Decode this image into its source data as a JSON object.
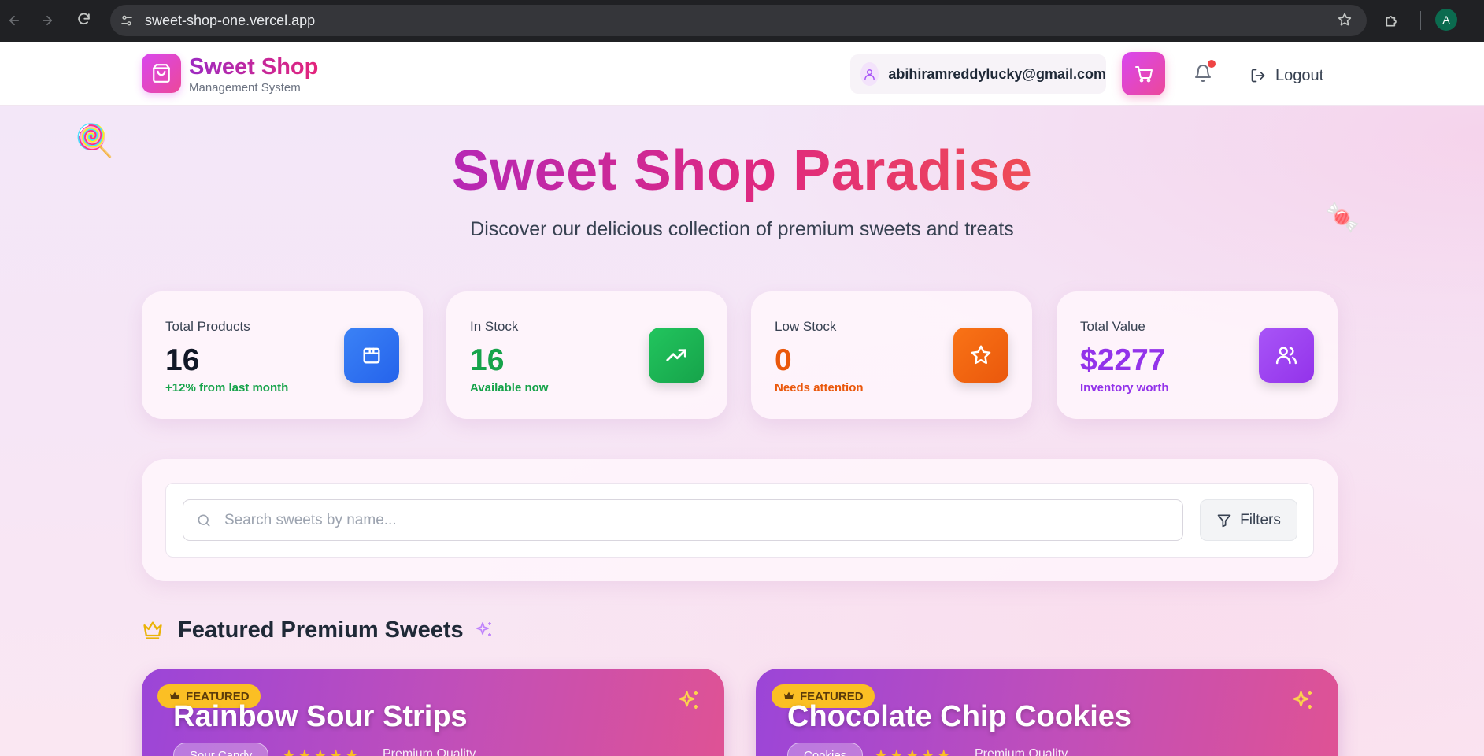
{
  "browser": {
    "url": "sweet-shop-one.vercel.app",
    "profile_initial": "A"
  },
  "header": {
    "brand_title": "Sweet Shop",
    "brand_subtitle": "Management System",
    "user_email": "abihiramreddylucky@gmail.com",
    "logout_label": "Logout",
    "notification_dot_color": "#ef4444"
  },
  "hero": {
    "title": "Sweet Shop Paradise",
    "subtitle": "Discover our delicious collection of premium sweets and treats"
  },
  "decorations": {
    "lollipop": "🍭",
    "candy": "🍬"
  },
  "stats": [
    {
      "label": "Total Products",
      "value": "16",
      "note": "+12% from last month",
      "value_color": "#111827",
      "note_color": "#16a34a",
      "icon": "box-icon",
      "icon_bg": "#3b82f6"
    },
    {
      "label": "In Stock",
      "value": "16",
      "note": "Available now",
      "value_color": "#16a34a",
      "note_color": "#16a34a",
      "icon": "trending-up-icon",
      "icon_bg": "#22c55e"
    },
    {
      "label": "Low Stock",
      "value": "0",
      "note": "Needs attention",
      "value_color": "#ea580c",
      "note_color": "#ea580c",
      "icon": "star-icon",
      "icon_bg": "#f97316"
    },
    {
      "label": "Total Value",
      "value": "$2277",
      "note": "Inventory worth",
      "value_color": "#9333ea",
      "note_color": "#9333ea",
      "icon": "users-icon",
      "icon_bg": "#a855f7"
    }
  ],
  "search": {
    "placeholder": "Search sweets by name...",
    "value": "",
    "filters_label": "Filters"
  },
  "featured": {
    "section_title": "Featured Premium Sweets",
    "badge_label": "FEATURED",
    "items": [
      {
        "name": "Rainbow Sour Strips",
        "category": "Sour Candy",
        "rating": "★★★★★",
        "quality": "Premium Quality"
      },
      {
        "name": "Chocolate Chip Cookies",
        "category": "Cookies",
        "rating": "★★★★★",
        "quality": "Premium Quality"
      }
    ]
  },
  "colors": {
    "brand_gradient_start": "#d946ef",
    "brand_gradient_end": "#ec4899",
    "badge_yellow": "#fbbf24"
  }
}
